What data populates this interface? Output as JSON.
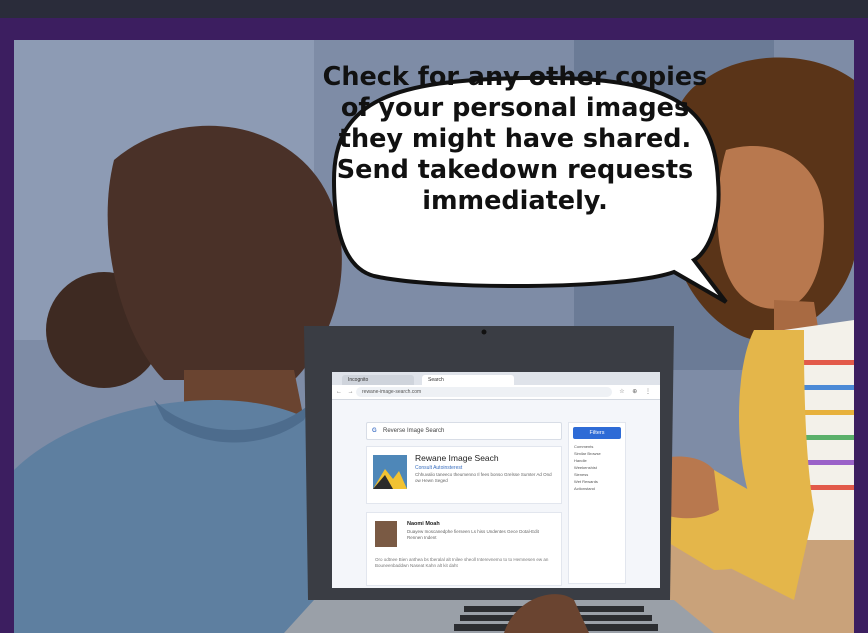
{
  "speech_bubble": {
    "text": "Check for any other copies of your personal images they might have shared. Send takedown requests immediately."
  },
  "browser": {
    "tab_inactive": "Incognito",
    "tab_active": "Search",
    "address": "rewane-image-search.com",
    "nav_icons": "← → ↻",
    "toolbar_icons": "☆ ⊕ ⋮"
  },
  "search_page": {
    "search_placeholder": "Reverse Image Search",
    "search_brand_glyph": "G",
    "result1": {
      "title": "Rewane Image Seach",
      "subtitle": "Consult Autoinsterest",
      "description": "Chhuvalio taneeco theumenno Il fees bonso Grelsse Sumter Ad Ond ow Hewn Seged"
    },
    "result2": {
      "title": "Naomi Moah",
      "description": "Duayew Inoscanedphe fierseen Ls hiss Undentes Gece Dotal-Edit Rennen Indent",
      "extra": "Oro odtnee Bien anthea bs tberalal alt Inilee sheoll Interevnemo to to Hemnesen ew an Bouneenbaddwn Naseat Kahn alt kit daht"
    },
    "sidebar": {
      "button": "Filters",
      "items": [
        "Comments",
        "Similar Browse",
        "Handle",
        "Weekenshist",
        "Sieness",
        "Wet Rewards",
        "Actionstand"
      ]
    }
  },
  "colors": {
    "frame": "#3c1e60",
    "bubble_fill": "#ffffff",
    "cardigan": "#e4b64a",
    "jacket": "#5e7fa0"
  }
}
